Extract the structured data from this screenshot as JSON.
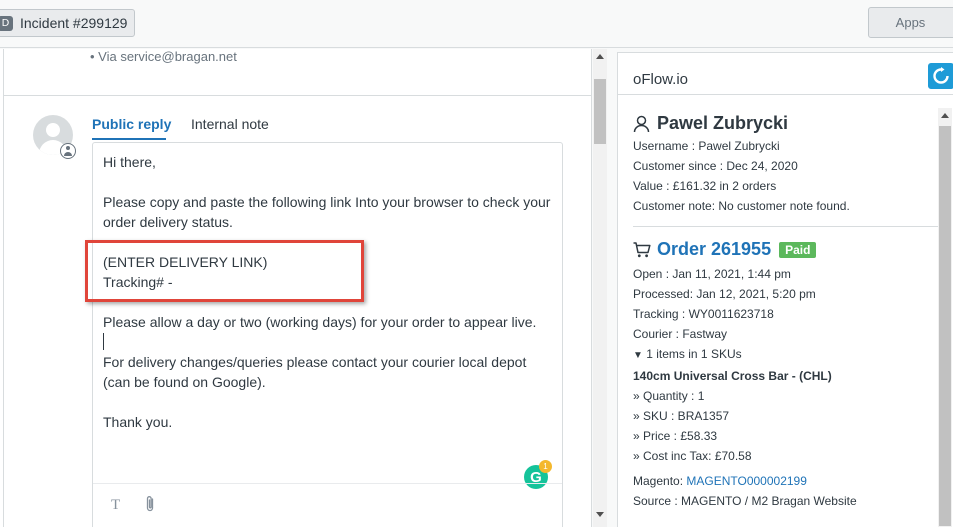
{
  "topbar": {
    "incident_tab_label": "Incident #299129",
    "incident_tab_icon": "ticket-icon",
    "apps_label": "Apps"
  },
  "conversation": {
    "via_text": "• Via service@bragan.net"
  },
  "composer": {
    "tab_public": "Public reply",
    "tab_internal": "Internal note",
    "lines": [
      "Hi there,",
      "Please copy and paste the following link Into your browser to check your",
      "order delivery status.",
      "(ENTER DELIVERY LINK)",
      "Tracking# -",
      "Please allow a day or two (working days) for your order to appear live.",
      "For delivery changes/queries please contact your courier local depot",
      "(can be found on Google).",
      "Thank you."
    ],
    "grammarly_count": "1",
    "grammarly_letter": "G",
    "highlight_color": "#e0453a",
    "toolbar_text_icon": "T"
  },
  "app": {
    "title": "oFlow.io",
    "customer": {
      "name": "Pawel Zubrycki",
      "username": "Username : Pawel Zubrycki",
      "since": "Customer since : Dec 24, 2020",
      "value": "Value : £161.32 in 2 orders",
      "note": "Customer note: No customer note found."
    },
    "order": {
      "title": "Order 261955",
      "status": "Paid",
      "status_color": "#5cb85c",
      "open": "Open : Jan 11, 2021, 1:44 pm",
      "processed": "Processed: Jan 12, 2021, 5:20 pm",
      "tracking": "Tracking : WY0011623718",
      "courier": "Courier : Fastway",
      "items_toggle": "▼",
      "items_link": "1 items in 1 SKUs",
      "product_name": "140cm Universal Cross Bar - (CHL)",
      "quantity": "» Quantity : 1",
      "sku": "» SKU : BRA1357",
      "price": "» Price : £58.33",
      "cost": "» Cost inc Tax: £70.58",
      "magento_label": "Magento: ",
      "magento_link": "MAGENTO000002199",
      "source": "Source : MAGENTO / M2 Bragan Website"
    }
  }
}
